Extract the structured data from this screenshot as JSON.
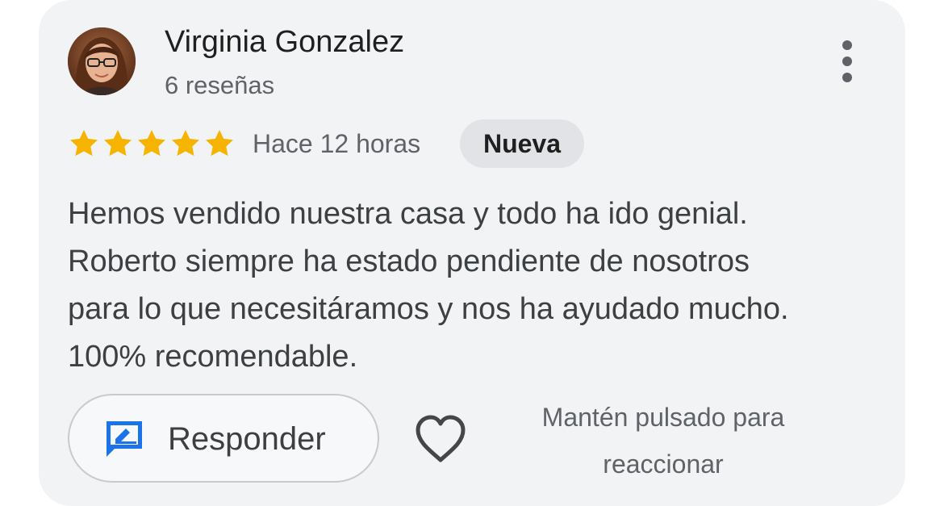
{
  "review": {
    "author": "Virginia Gonzalez",
    "review_count": "6 reseñas",
    "rating": 5,
    "max_rating": 5,
    "time": "Hace 12 horas",
    "badge": "Nueva",
    "text_lines": [
      "Hemos vendido nuestra casa y todo ha ido genial.",
      "Roberto siempre ha estado pendiente de nosotros",
      "para lo que necesitáramos y nos ha ayudado mucho.",
      "100% recomendable."
    ]
  },
  "actions": {
    "reply_label": "Responder",
    "reply_icon": "reply-edit-icon",
    "like_icon": "heart-icon",
    "more_icon": "more-vert-icon",
    "hint_lines": [
      "Mantén pulsado para",
      "reaccionar"
    ]
  },
  "colors": {
    "star": "#f6b400",
    "reply_icon": "#1a73e8",
    "card_background": "#f2f3f5",
    "badge_background": "#e1e3e6"
  }
}
